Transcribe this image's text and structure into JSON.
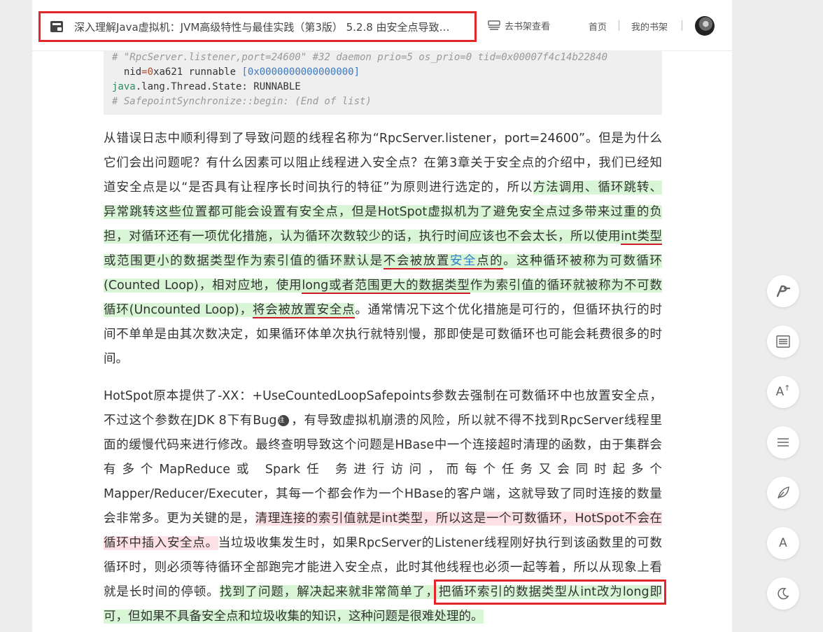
{
  "header": {
    "book_title": "深入理解Java虚拟机：JVM高级特性与最佳实践（第3版） 5.2.8 由安全点导致…",
    "shelf_view": "去书架查看",
    "nav": [
      "首页",
      "我的书架"
    ]
  },
  "code": {
    "line1": "# \"RpcServer.listener,port=24600\" #32 daemon prio=5 os_prio=0 tid=0x00007f4c14b22840",
    "line2_a": "  nid",
    "line2_eq": "=",
    "line2_b": "0",
    "line2_c": "xa621 runnable ",
    "line2_d": "[0x0000000000000000]",
    "line3_a": "java",
    "line3_b": ".lang.Thread.State: RUNNABLE",
    "line4": "# SafepointSynchronize::begin: (End of list)"
  },
  "para1": {
    "l1": "从错误日志中顺利得到了导致问题的线程名称为“RpcServer.listener，port=24600”。但是为什么",
    "l2": "它们会出问题呢？有什么因素可以阻止线程进入安全点？在第3章关于安全点的介绍中，我们已经知",
    "l3_a": "道安全点是以“是否具有让程序长时间执行的特征”为原则进行选定的，所以",
    "l3_b": "方法调用、循环跳转、",
    "l4": "异常跳转这些位置都可能会设置有安全点，但是HotSpot虚拟机为了避免安全点过多带来过重的负",
    "l5_a": "担，对循环还有一项优化措施，认为循环次数较少的话，执行时间应该也不会太长，所以使用",
    "l5_b": "int类型",
    "l6_a": "或范围更小的数据类型作为索引值的循环默认是",
    "l6_b": "不会被放置",
    "l6_c": "安全",
    "l6_d": "点的",
    "l6_e": "。这种循环被称为可数循环",
    "l7_a": "(Counted Loop)，相对应地，使用",
    "l7_b": "long或者范围更大的数据类型",
    "l7_c": "作为索引值的循环就被称为不可数",
    "l8_a": "循环(Uncounted Loop)，",
    "l8_b": "将会被放置安全点",
    "l8_c": "。通常情况下这个优化措施是可行的，但循环执行的时",
    "l9": "间不单单是由其次数决定，如果循环体单次执行就特别慢，那即使是可数循环也可能会耗费很多的时",
    "l10": "间。"
  },
  "para2": {
    "l1": "HotSpot原本提供了-XX：+UseCountedLoopSafepoints参数去强制在可数循环中也放置安全点，",
    "l2_a": "不过这个参数在JDK 8下有Bug",
    "l2_note": "注",
    "l2_b": "，有导致虚拟机崩溃的风险，所以就不得不找到RpcServer线程里",
    "l3": "面的缓慢代码来进行修改。最终查明导致这个问题是HBase中一个连接超时清理的函数，由于集群会",
    "l4": "有多个MapReduce或 Spark任 务进行访问，而每个任务又会同时起多个",
    "l5": "Mapper/Reducer/Executer，其每一个都会作为一个HBase的客户端，这就导致了同时连接的数量",
    "l6_a": "会非常多。更为关键的是，",
    "l6_b": "清理连接的索引值就是int类型，所以这是一个可数循环，HotSpot不会在",
    "l7_a": "循环中插入安全点。",
    "l7_b": "当垃圾收集发生时，如果RpcServer的Listener线程刚好执行到该函数里的可数",
    "l8": "循环时，则必须等待循环全部跑完才能进入安全点，此时其他线程也必须一起等着，所以从现象上看",
    "l9_a": "就是长时间的停顿。",
    "l9_b": "找到了问题，解决起来就非常简单了，",
    "l9_c": "把循环索引的数据类型从int改为long即",
    "l10": "可，但如果不具备安全点和垃圾收集的知识，这种问题是很难处理的。"
  },
  "toolbar": {
    "font_label": "A",
    "font_size_label": "A"
  }
}
